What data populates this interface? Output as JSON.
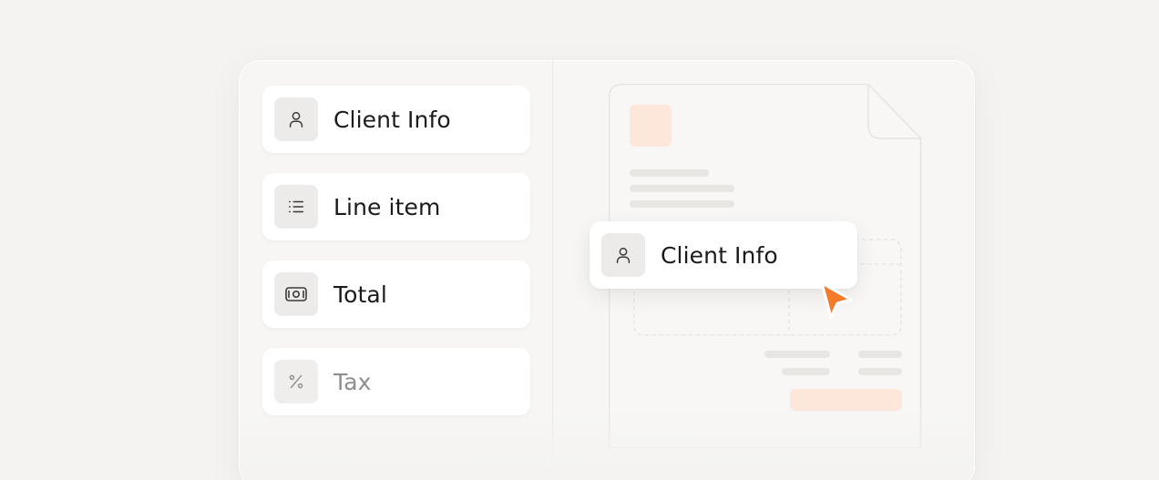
{
  "palette": {
    "background": "#f4f3f1",
    "card": "#f7f6f4",
    "block": "#ffffff",
    "icon_bg": "#ecebe9",
    "accent": "#f57a2a",
    "accent_light": "#fde6da"
  },
  "blocks": [
    {
      "label": "Client Info",
      "icon": "user-icon"
    },
    {
      "label": "Line item",
      "icon": "list-icon"
    },
    {
      "label": "Total",
      "icon": "banknote-icon"
    },
    {
      "label": "Tax",
      "icon": "percent-icon"
    }
  ],
  "dragging": {
    "label": "Client Info",
    "icon": "user-icon"
  },
  "cursor": {
    "icon": "pointer-arrow-icon"
  }
}
